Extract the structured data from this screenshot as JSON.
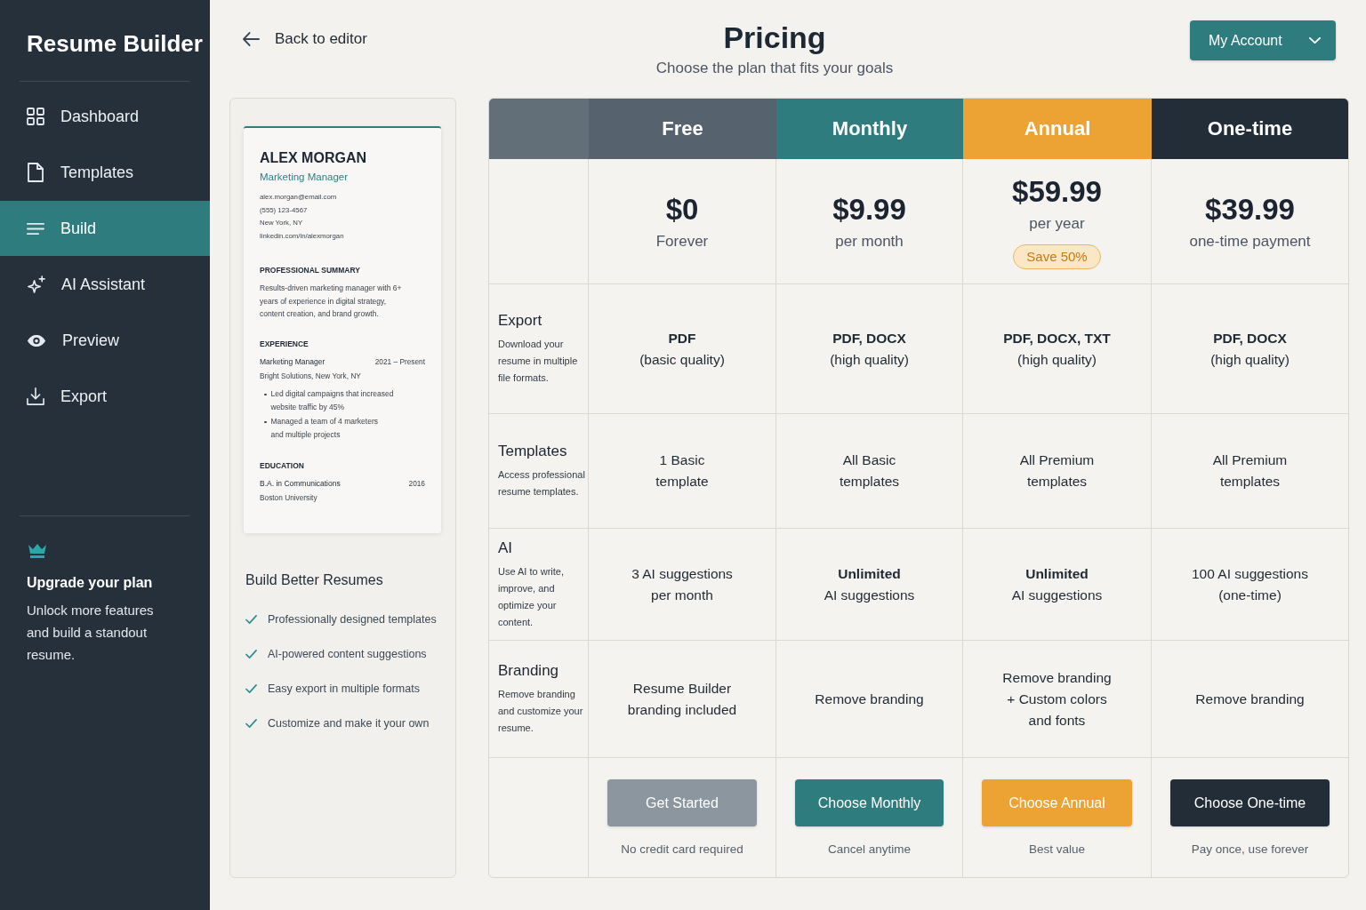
{
  "sidebar": {
    "title": "Resume Builder",
    "nav": [
      {
        "label": "Dashboard",
        "selected": false
      },
      {
        "label": "Templates",
        "selected": false
      },
      {
        "label": "Build",
        "selected": true
      },
      {
        "label": "AI Assistant",
        "selected": false
      },
      {
        "label": "Preview",
        "selected": false
      },
      {
        "label": "Export",
        "selected": false
      }
    ],
    "upgrade": {
      "title": "Upgrade your plan",
      "text": "Unlock more features and build a standout resume."
    }
  },
  "header": {
    "back_link": "Back to editor",
    "title": "Pricing",
    "subtitle": "Choose the plan that fits your goals",
    "account_button": "My Account"
  },
  "resume_preview": {
    "name": "ALEX MORGAN",
    "role": "Marketing Manager",
    "contact": [
      "alex.morgan@email.com",
      "(555) 123-4567",
      "New York, NY",
      "linkedin.com/in/alexmorgan"
    ],
    "summary": {
      "heading": "PROFESSIONAL SUMMARY",
      "text": "Results-driven marketing manager with 6+ years of experience in digital strategy, content creation, and brand growth."
    },
    "experience": {
      "heading": "EXPERIENCE",
      "title": "Marketing Manager",
      "dates": "2021 – Present",
      "company": "Bright Solutions, New York, NY",
      "bullets": [
        "Led digital campaigns that increased\nwebsite traffic by 45%",
        "Managed a team of 4 marketers\nand multiple projects"
      ]
    },
    "education": {
      "heading": "EDUCATION",
      "degree": "B.A. in Communications",
      "year": "2016",
      "school": "Boston University"
    }
  },
  "benefits": {
    "title": "Build Better Resumes",
    "items": [
      "Professionally designed templates",
      "AI-powered content suggestions",
      "Easy export in multiple formats",
      "Customize and make it your own"
    ]
  },
  "pricing_table": {
    "plans": [
      {
        "name": "Free",
        "color": "#56626d",
        "price": "$0",
        "period": "Forever",
        "button": {
          "label": "Get Started",
          "color": "#8b969f"
        },
        "note": "No credit card required"
      },
      {
        "name": "Monthly",
        "color": "#2e7c7e",
        "price": "$9.99",
        "period": "per month",
        "button": {
          "label": "Choose Monthly",
          "color": "#2e7c7e"
        },
        "note": "Cancel anytime"
      },
      {
        "name": "Annual",
        "color": "#eda333",
        "price": "$59.99",
        "period": "per year",
        "badge": "Save 50%",
        "button": {
          "label": "Choose Annual",
          "color": "#eda333"
        },
        "note": "Best value"
      },
      {
        "name": "One-time",
        "color": "#222d38",
        "price": "$39.99",
        "period": "one-time payment",
        "button": {
          "label": "Choose One-time",
          "color": "#222d38"
        },
        "note": "Pay once, use forever"
      }
    ],
    "features": [
      {
        "name": "Export",
        "description": "Download your resume in multiple file formats.",
        "values": [
          "**PDF**\n(basic quality)",
          "**PDF, DOCX**\n(high quality)",
          "**PDF, DOCX, TXT**\n(high quality)",
          "**PDF, DOCX**\n(high quality)"
        ]
      },
      {
        "name": "Templates",
        "description": "Access professional resume templates.",
        "values": [
          "1 Basic\ntemplate",
          "All Basic\ntemplates",
          "All Premium\ntemplates",
          "All Premium\ntemplates"
        ]
      },
      {
        "name": "AI",
        "description": "Use AI to write, improve, and optimize your content.",
        "values": [
          "3 AI suggestions\nper month",
          "**Unlimited**\nAI suggestions",
          "**Unlimited**\nAI suggestions",
          "100 AI suggestions\n(one-time)"
        ]
      },
      {
        "name": "Branding",
        "description": "Remove branding and customize your resume.",
        "values": [
          "Resume Builder\nbranding included",
          "Remove branding",
          "Remove branding\n+ Custom colors\nand fonts",
          "Remove branding"
        ]
      }
    ]
  }
}
